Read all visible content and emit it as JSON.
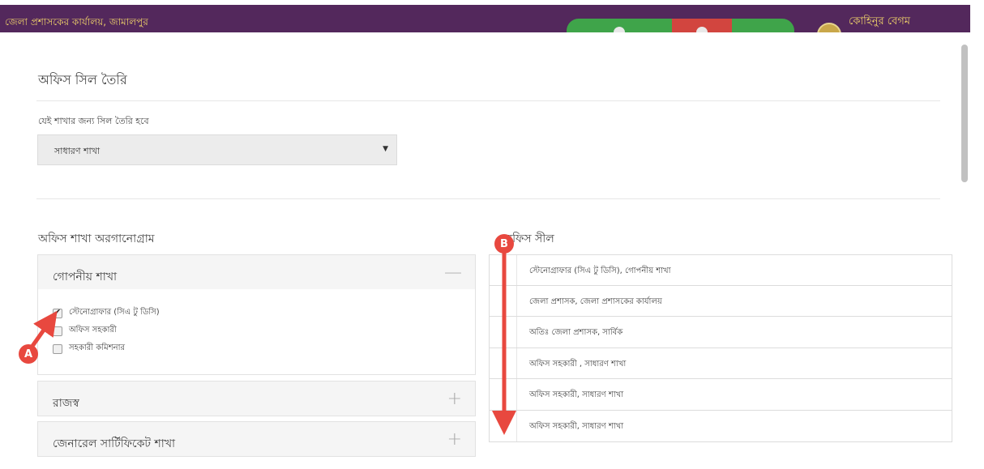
{
  "header": {
    "office_name": "জেলা প্রশাসকের কার্যালয়, জামালপুর",
    "user_name": "কোহিনুর বেগম"
  },
  "page": {
    "title": "অফিস সিল তৈরি",
    "branch_label": "যেই শাখার জন্য সিল তৈরি হবে",
    "branch_selected": "সাধারণ শাখা"
  },
  "organogram": {
    "title": "অফিস শাখা অরগানোগ্রাম",
    "sections": [
      {
        "title": "গোপনীয় শাখা",
        "toggle": "—",
        "expanded": true
      },
      {
        "title": "রাজস্ব",
        "toggle": "+"
      },
      {
        "title": "জেনারেল সার্টিফিকেট শাখা",
        "toggle": "+"
      }
    ],
    "options": [
      {
        "label": "স্টেনোগ্রাফার (সিএ টু ডিসি)",
        "checked": true
      },
      {
        "label": "অফিস সহকারী",
        "checked": false
      },
      {
        "label": "সহকারী কমিশনার",
        "checked": false
      }
    ]
  },
  "seal": {
    "title": "অফিস সীল",
    "rows": [
      "স্টেনোগ্রাফার (সিএ টু ডিসি), গোপনীয় শাখা",
      "জেলা প্রশাসক, জেলা প্রশাসকের কার্যালয়",
      "অতিঃ জেলা প্রশাসক, সার্বিক",
      "অফিস সহকারী , সাধারণ শাখা",
      "অফিস সহকারী, সাধারণ শাখা",
      "অফিস সহকারী, সাধারণ শাখা"
    ]
  },
  "annotations": {
    "a": "A",
    "b": "B"
  },
  "colors": {
    "topbar": "#53285c",
    "accent_red": "#e8483f",
    "green": "#3fa44a"
  }
}
